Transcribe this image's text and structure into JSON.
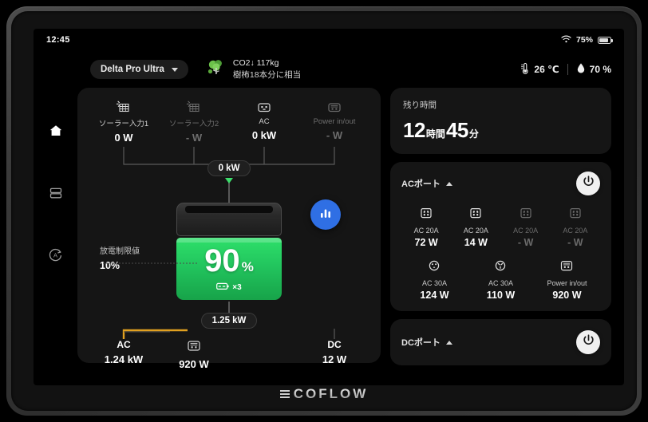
{
  "status": {
    "time": "12:45",
    "wifi_icon": "wifi-icon",
    "battery_percent": "75%",
    "battery_icon": "battery-icon"
  },
  "header": {
    "device_name": "Delta Pro Ultra",
    "chevron_icon": "chevron-down-icon",
    "tree_icon": "tree-icon",
    "co2_line1": "CO2↓ 117kg",
    "co2_line2": "樹柨18本分に相当",
    "temp_icon": "thermometer-icon",
    "temperature": "26 ℃",
    "humidity_icon": "humidity-icon",
    "humidity": "70 %"
  },
  "rail": {
    "items": [
      {
        "name": "sidebar-item-home",
        "icon": "home-icon",
        "active": true
      },
      {
        "name": "sidebar-item-devices",
        "icon": "rows-icon",
        "active": false
      },
      {
        "name": "sidebar-item-auto",
        "icon": "auto-circle-icon",
        "active": false
      }
    ]
  },
  "flow": {
    "inputs": [
      {
        "icon": "solar-panel-icon",
        "label": "ソーラー入力1",
        "value": "0 W",
        "dim": false
      },
      {
        "icon": "solar-panel-icon",
        "label": "ソーラー入力2",
        "value": "- W",
        "dim": true
      },
      {
        "icon": "ac-plug-icon",
        "label": "AC",
        "value": "0 kW",
        "dim": false
      },
      {
        "icon": "power-inout-icon",
        "label": "Power in/out",
        "value": "- W",
        "dim": true
      }
    ],
    "input_total": "0 kW",
    "input_arrow_color": "#3ddc6b",
    "battery": {
      "soc": "90",
      "soc_unit": "%",
      "pack_icon": "battery-pack-icon",
      "pack_count": "×3",
      "fill_color": "#22c55e"
    },
    "limit_label": "放電制限値",
    "limit_value": "10%",
    "stats_icon": "bar-chart-icon",
    "output_total": "1.25 kW",
    "output_arrow_color": "#e0a020",
    "outputs": [
      {
        "label": "AC",
        "value": "1.24 kW",
        "icon": null
      },
      {
        "label": "",
        "value": "920 W",
        "icon": "power-inout-icon"
      },
      {
        "label": "DC",
        "value": "12 W",
        "icon": null
      }
    ]
  },
  "remaining": {
    "title": "残り時間",
    "hours": "12",
    "hours_unit": "時間",
    "minutes": "45",
    "minutes_unit": "分"
  },
  "ac_panel": {
    "title": "ACポート",
    "collapse_icon": "chevron-up-icon",
    "power_icon": "power-icon",
    "ports_row1": [
      {
        "icon": "ac-outlet-icon",
        "name": "AC 20A",
        "watts": "72 W",
        "dim": false
      },
      {
        "icon": "ac-outlet-icon",
        "name": "AC 20A",
        "watts": "14 W",
        "dim": false
      },
      {
        "icon": "ac-outlet-icon",
        "name": "AC 20A",
        "watts": "- W",
        "dim": true
      },
      {
        "icon": "ac-outlet-icon",
        "name": "AC 20A",
        "watts": "- W",
        "dim": true
      }
    ],
    "ports_row2": [
      {
        "icon": "ac-30a-icon",
        "name": "AC 30A",
        "watts": "124 W",
        "dim": false
      },
      {
        "icon": "ac-30a-round-icon",
        "name": "AC 30A",
        "watts": "110 W",
        "dim": false
      },
      {
        "icon": "power-inout-icon",
        "name": "Power in/out",
        "watts": "920 W",
        "dim": false
      }
    ]
  },
  "dc_panel": {
    "title": "DCポート",
    "collapse_icon": "chevron-up-icon",
    "power_icon": "power-icon"
  },
  "brand": {
    "logo_text": "COFLOW"
  }
}
